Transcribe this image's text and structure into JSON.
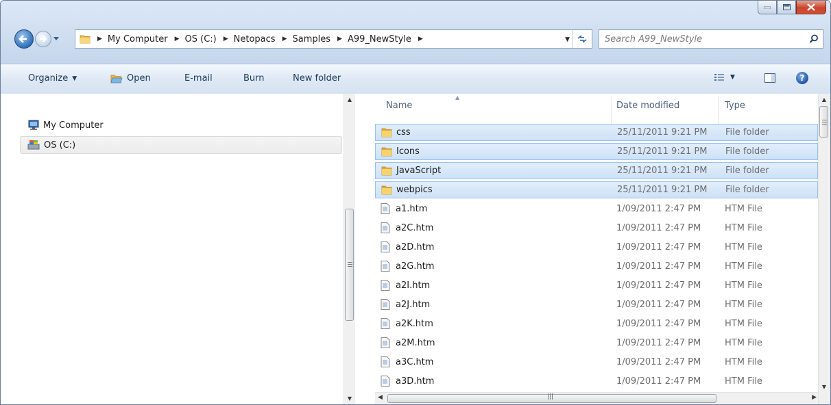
{
  "address": {
    "crumbs": [
      "My Computer",
      "OS (C:)",
      "Netopacs",
      "Samples",
      "A99_NewStyle"
    ]
  },
  "search": {
    "placeholder": "Search A99_NewStyle"
  },
  "toolbar": {
    "organize": "Organize",
    "open": "Open",
    "email": "E-mail",
    "burn": "Burn",
    "new_folder": "New folder"
  },
  "nav": {
    "computer": "My Computer",
    "drive": "OS (C:)"
  },
  "columns": {
    "name": "Name",
    "date": "Date modified",
    "type": "Type"
  },
  "files": [
    {
      "name": "css",
      "date": "25/11/2011 9:21 PM",
      "type": "File folder",
      "kind": "folder-icon"
    },
    {
      "name": "Icons",
      "date": "25/11/2011 9:21 PM",
      "type": "File folder",
      "kind": "folder-icon"
    },
    {
      "name": "JavaScript",
      "date": "25/11/2011 9:21 PM",
      "type": "File folder",
      "kind": "folder-icon"
    },
    {
      "name": "webpics",
      "date": "25/11/2011 9:21 PM",
      "type": "File folder",
      "kind": "folder-icon"
    },
    {
      "name": "a1.htm",
      "date": "1/09/2011 2:47 PM",
      "type": "HTM File",
      "kind": "document-icon"
    },
    {
      "name": "a2C.htm",
      "date": "1/09/2011 2:47 PM",
      "type": "HTM File",
      "kind": "document-icon"
    },
    {
      "name": "a2D.htm",
      "date": "1/09/2011 2:47 PM",
      "type": "HTM File",
      "kind": "document-icon"
    },
    {
      "name": "a2G.htm",
      "date": "1/09/2011 2:47 PM",
      "type": "HTM File",
      "kind": "document-icon"
    },
    {
      "name": "a2I.htm",
      "date": "1/09/2011 2:47 PM",
      "type": "HTM File",
      "kind": "document-icon"
    },
    {
      "name": "a2J.htm",
      "date": "1/09/2011 2:47 PM",
      "type": "HTM File",
      "kind": "document-icon"
    },
    {
      "name": "a2K.htm",
      "date": "1/09/2011 2:47 PM",
      "type": "HTM File",
      "kind": "document-icon"
    },
    {
      "name": "a2M.htm",
      "date": "1/09/2011 2:47 PM",
      "type": "HTM File",
      "kind": "document-icon"
    },
    {
      "name": "a3C.htm",
      "date": "1/09/2011 2:47 PM",
      "type": "HTM File",
      "kind": "document-icon"
    },
    {
      "name": "a3D.htm",
      "date": "1/09/2011 2:47 PM",
      "type": "HTM File",
      "kind": "document-icon"
    }
  ],
  "selected_count": 4,
  "colors": {
    "selection_bg": "#cde1f7",
    "selection_border": "#99c2ee",
    "frame": "#c4d6ec"
  }
}
